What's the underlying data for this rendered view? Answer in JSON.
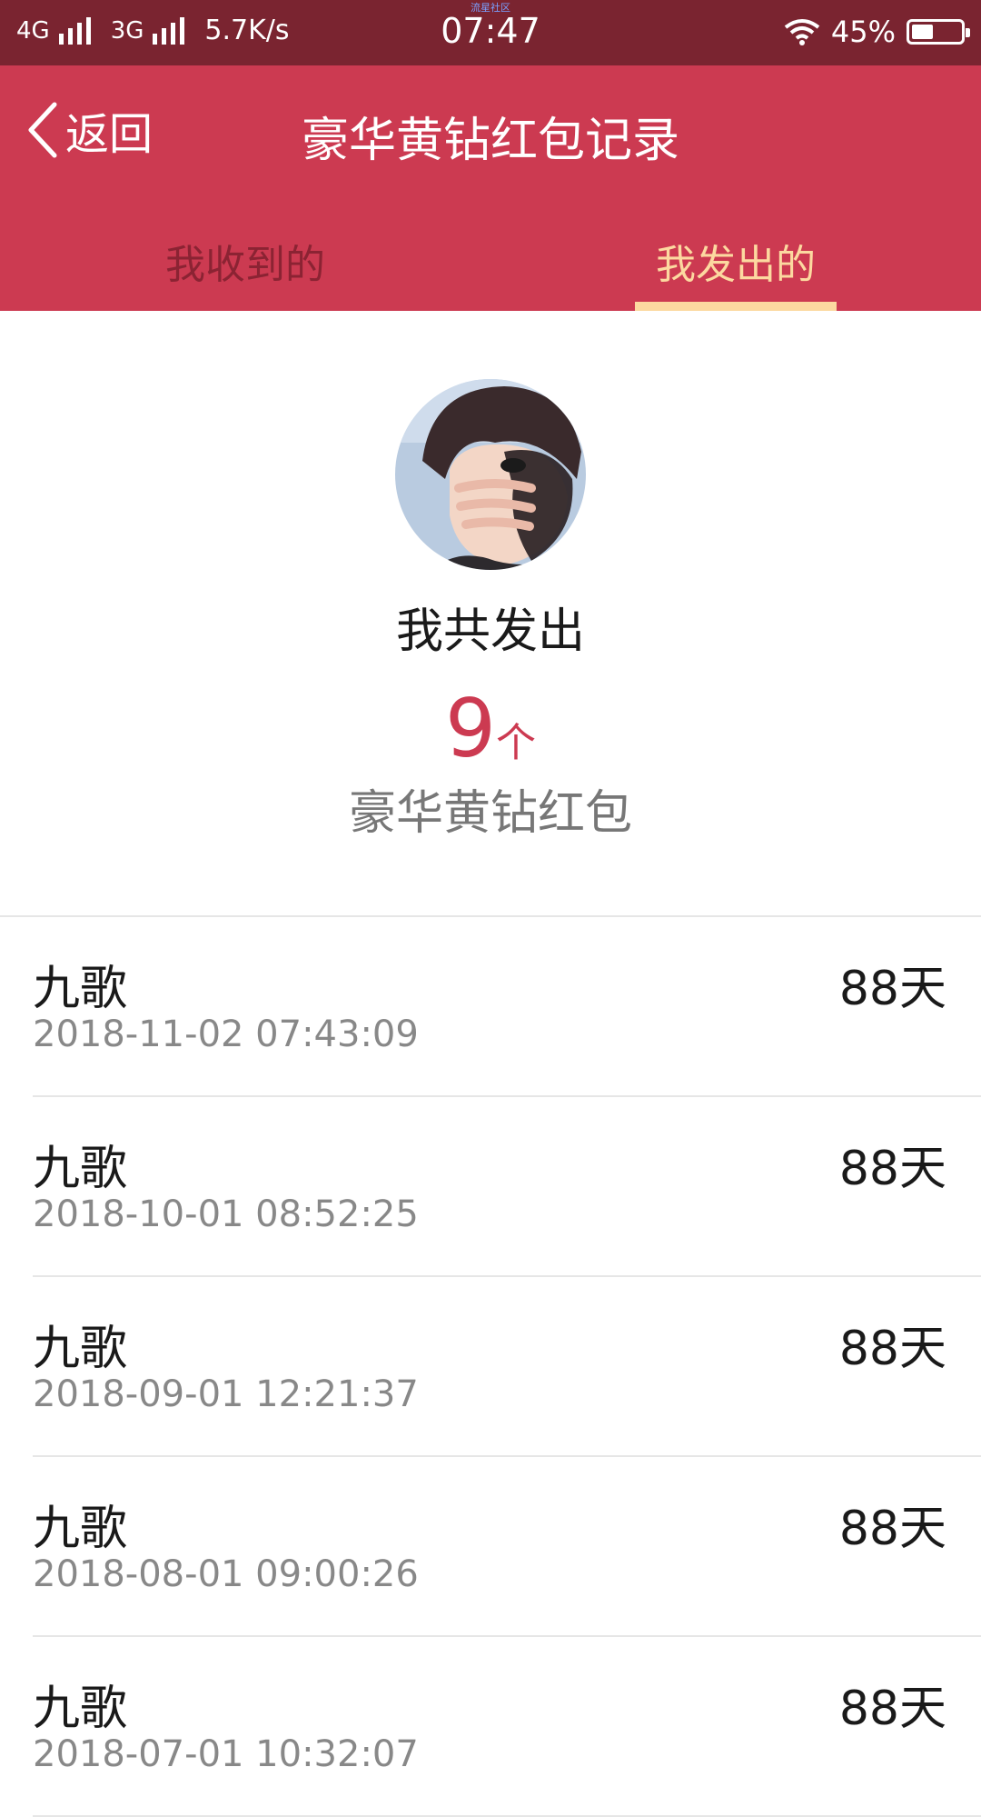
{
  "status_bar": {
    "network_1": "4G",
    "network_2": "3G",
    "speed": "5.7K/s",
    "time": "07:47",
    "watermark": "流星社区",
    "battery": "45%",
    "battery_level": 0.45
  },
  "header": {
    "back_label": "返回",
    "title": "豪华黄钻红包记录"
  },
  "tabs": [
    {
      "label": "我收到的",
      "active": false
    },
    {
      "label": "我发出的",
      "active": true
    }
  ],
  "summary": {
    "label": "我共发出",
    "count": "9",
    "unit": "个",
    "packet_name": "豪华黄钻红包"
  },
  "records": [
    {
      "name": "九歌",
      "time": "2018-11-02 07:43:09",
      "duration": "88天"
    },
    {
      "name": "九歌",
      "time": "2018-10-01 08:52:25",
      "duration": "88天"
    },
    {
      "name": "九歌",
      "time": "2018-09-01 12:21:37",
      "duration": "88天"
    },
    {
      "name": "九歌",
      "time": "2018-08-01 09:00:26",
      "duration": "88天"
    },
    {
      "name": "九歌",
      "time": "2018-07-01 10:32:07",
      "duration": "88天"
    }
  ],
  "colors": {
    "status_bar": "#7a2430",
    "header": "#cc3a51",
    "active_tab": "#fcd9a0",
    "inactive_tab": "#8b2333",
    "accent": "#cc3a51"
  },
  "icons": {
    "back": "chevron-left-icon",
    "wifi": "wifi-icon",
    "battery": "battery-icon",
    "signal": "signal-bars-icon"
  }
}
